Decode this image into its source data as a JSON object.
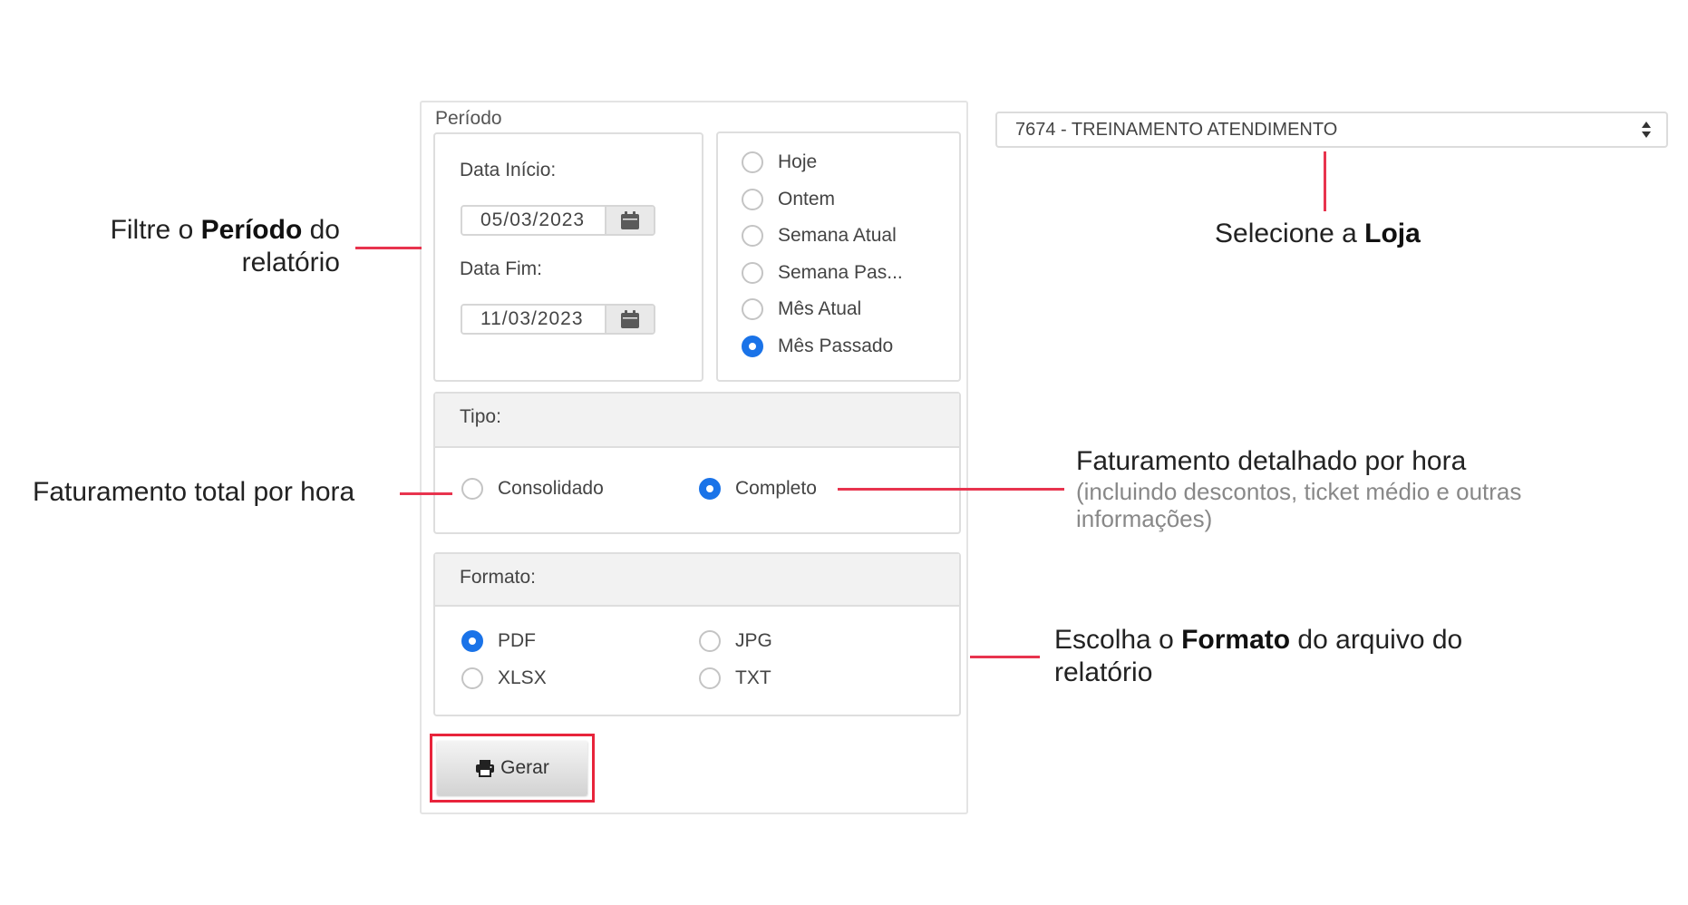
{
  "periodo": {
    "legend": "Período",
    "data_inicio_label": "Data Início:",
    "data_inicio_value": "05/03/2023",
    "data_fim_label": "Data Fim:",
    "data_fim_value": "11/03/2023",
    "calendar_icon": "calendar-icon",
    "quick_options": [
      {
        "label": "Hoje",
        "checked": false
      },
      {
        "label": "Ontem",
        "checked": false
      },
      {
        "label": "Semana Atual",
        "checked": false
      },
      {
        "label": "Semana Pas...",
        "checked": false
      },
      {
        "label": "Mês Atual",
        "checked": false
      },
      {
        "label": "Mês Passado",
        "checked": true
      }
    ]
  },
  "tipo": {
    "header": "Tipo:",
    "options": [
      {
        "label": "Consolidado",
        "checked": false
      },
      {
        "label": "Completo",
        "checked": true
      }
    ]
  },
  "formato": {
    "header": "Formato:",
    "options": [
      {
        "label": "PDF",
        "checked": true
      },
      {
        "label": "JPG",
        "checked": false
      },
      {
        "label": "XLSX",
        "checked": false
      },
      {
        "label": "TXT",
        "checked": false
      }
    ]
  },
  "loja": {
    "selected": "7674 - TREINAMENTO ATENDIMENTO",
    "icon": "sort-arrows-icon"
  },
  "gerar_button": {
    "label": "Gerar",
    "icon": "printer-icon"
  },
  "annotations": {
    "periodo_pre": "Filtre o ",
    "periodo_bold": "Período",
    "periodo_post": " do",
    "periodo_line2": "relatório",
    "loja_pre": "Selecione a ",
    "loja_bold": "Loja",
    "consolidado": "Faturamento total por hora",
    "completo_title": "Faturamento detalhado por hora",
    "completo_sub1": "(incluindo descontos, ticket médio e outras",
    "completo_sub2": "informações)",
    "formato_pre": "Escolha o ",
    "formato_bold": "Formato",
    "formato_post": " do arquivo do",
    "formato_line2": "relatório"
  },
  "colors": {
    "accent_red": "#e8344e",
    "radio_blue": "#1a73e8"
  }
}
